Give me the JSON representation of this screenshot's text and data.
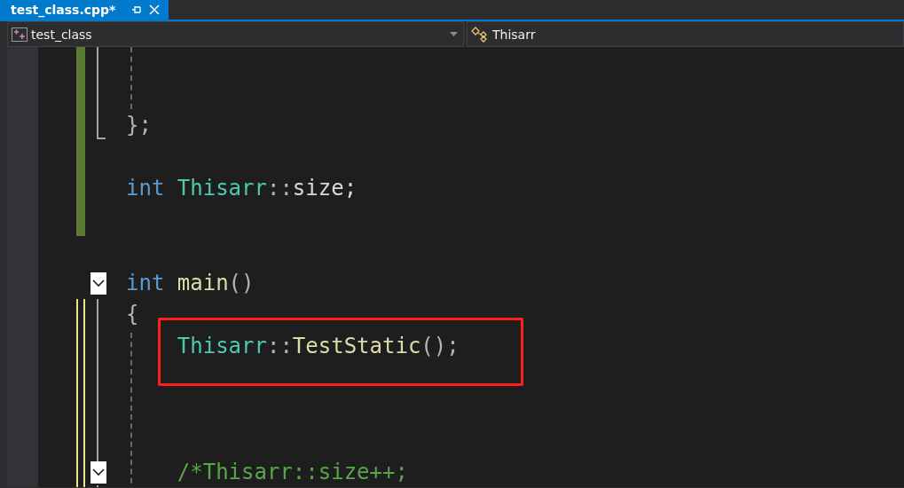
{
  "tab": {
    "title": "test_class.cpp*",
    "selected": true
  },
  "navigation": {
    "scope": "test_class",
    "member": "Thisarr"
  },
  "lines": [
    {
      "kind": "blank",
      "change_bar": {
        "saved": true
      }
    },
    {
      "kind": "blank",
      "change_bar": {
        "saved": true
      }
    },
    {
      "kind": "code",
      "change_bar": {
        "saved": true
      },
      "tokens": [
        {
          "kind": "punct",
          "text": "};"
        }
      ]
    },
    {
      "kind": "blank",
      "change_bar": {
        "saved": true
      }
    },
    {
      "kind": "code",
      "change_bar": {
        "saved": true
      },
      "tokens": [
        {
          "kind": "keyword",
          "text": "int"
        },
        {
          "kind": "type",
          "text": " Thisarr"
        },
        {
          "kind": "punct",
          "text": "::"
        },
        {
          "kind": "plain",
          "text": "size;"
        }
      ]
    },
    {
      "kind": "blank",
      "change_bar": {
        "saved": true
      }
    },
    {
      "kind": "blank"
    },
    {
      "kind": "code",
      "fold": true,
      "tokens": [
        {
          "kind": "keyword",
          "text": "int"
        },
        {
          "kind": "function",
          "text": " main"
        },
        {
          "kind": "punct",
          "text": "()"
        }
      ]
    },
    {
      "kind": "code",
      "change_bar": {
        "saved": false
      },
      "tokens": [
        {
          "kind": "punct",
          "text": "{"
        }
      ]
    },
    {
      "kind": "code",
      "change_bar": {
        "saved": false
      },
      "tokens": [
        {
          "kind": "type",
          "text": "    Thisarr"
        },
        {
          "kind": "punct",
          "text": "::"
        },
        {
          "kind": "function",
          "text": "TestStatic"
        },
        {
          "kind": "punct",
          "text": "();"
        }
      ]
    },
    {
      "kind": "blank",
      "change_bar": {
        "saved": false
      }
    },
    {
      "kind": "blank",
      "change_bar": {
        "saved": false
      }
    },
    {
      "kind": "blank",
      "change_bar": {
        "saved": false
      }
    },
    {
      "kind": "code",
      "change_bar": {
        "saved": false
      },
      "fold": true,
      "tokens": [
        {
          "kind": "comment",
          "text": "    /*Thisarr::size++;"
        }
      ]
    }
  ]
}
